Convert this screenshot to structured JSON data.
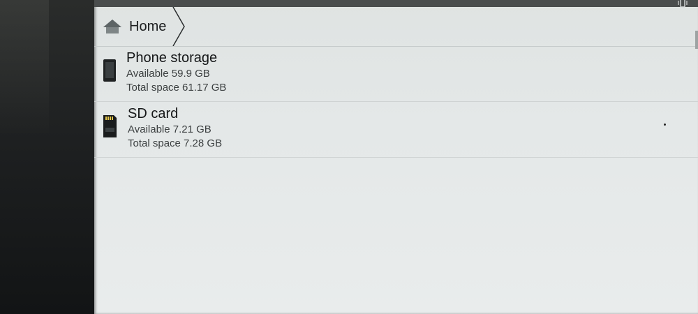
{
  "breadcrumb": {
    "home_label": "Home"
  },
  "storage_items": [
    {
      "name": "Phone storage",
      "available": "Available 59.9 GB",
      "total": "Total space 61.17 GB",
      "icon": "phone-icon"
    },
    {
      "name": "SD card",
      "available": "Available 7.21 GB",
      "total": "Total space 7.28 GB",
      "icon": "sd-card-icon"
    }
  ],
  "colors": {
    "status_bar": "#4a4d4d",
    "screen_background": "#e4e8e8",
    "divider": "#cfd3d3"
  }
}
